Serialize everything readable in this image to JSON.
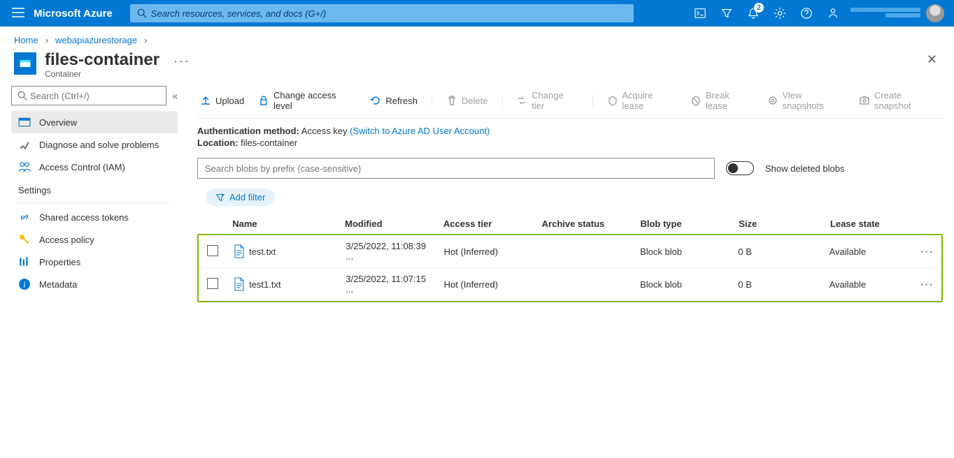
{
  "topbar": {
    "brand": "Microsoft Azure",
    "search_placeholder": "Search resources, services, and docs (G+/)",
    "notification_count": "2"
  },
  "breadcrumb": {
    "items": [
      "Home",
      "webapiazurestorage"
    ]
  },
  "page": {
    "title": "files-container",
    "subtitle": "Container"
  },
  "sidebar": {
    "search_placeholder": "Search (Ctrl+/)",
    "items": [
      {
        "label": "Overview",
        "icon": "overview-icon"
      },
      {
        "label": "Diagnose and solve problems",
        "icon": "diagnose-icon"
      },
      {
        "label": "Access Control (IAM)",
        "icon": "iam-icon"
      }
    ],
    "section_title": "Settings",
    "settings_items": [
      {
        "label": "Shared access tokens",
        "icon": "link-icon"
      },
      {
        "label": "Access policy",
        "icon": "key-icon"
      },
      {
        "label": "Properties",
        "icon": "props-icon"
      },
      {
        "label": "Metadata",
        "icon": "info-icon"
      }
    ]
  },
  "toolbar": {
    "upload": "Upload",
    "change_access": "Change access level",
    "refresh": "Refresh",
    "delete": "Delete",
    "change_tier": "Change tier",
    "acquire_lease": "Acquire lease",
    "break_lease": "Break lease",
    "view_snapshots": "View snapshots",
    "create_snapshot": "Create snapshot"
  },
  "auth": {
    "label": "Authentication method:",
    "value": "Access key",
    "switch_link": "(Switch to Azure AD User Account)"
  },
  "location": {
    "label": "Location:",
    "value": "files-container"
  },
  "blob_search_placeholder": "Search blobs by prefix (case-sensitive)",
  "show_deleted_label": "Show deleted blobs",
  "add_filter_label": "Add filter",
  "table": {
    "headers": {
      "name": "Name",
      "modified": "Modified",
      "access_tier": "Access tier",
      "archive_status": "Archive status",
      "blob_type": "Blob type",
      "size": "Size",
      "lease_state": "Lease state"
    },
    "rows": [
      {
        "name": "test.txt",
        "modified": "3/25/2022, 11:08:39 ...",
        "access_tier": "Hot (Inferred)",
        "archive_status": "",
        "blob_type": "Block blob",
        "size": "0 B",
        "lease_state": "Available"
      },
      {
        "name": "test1.txt",
        "modified": "3/25/2022, 11:07:15 ...",
        "access_tier": "Hot (Inferred)",
        "archive_status": "",
        "blob_type": "Block blob",
        "size": "0 B",
        "lease_state": "Available"
      }
    ]
  }
}
